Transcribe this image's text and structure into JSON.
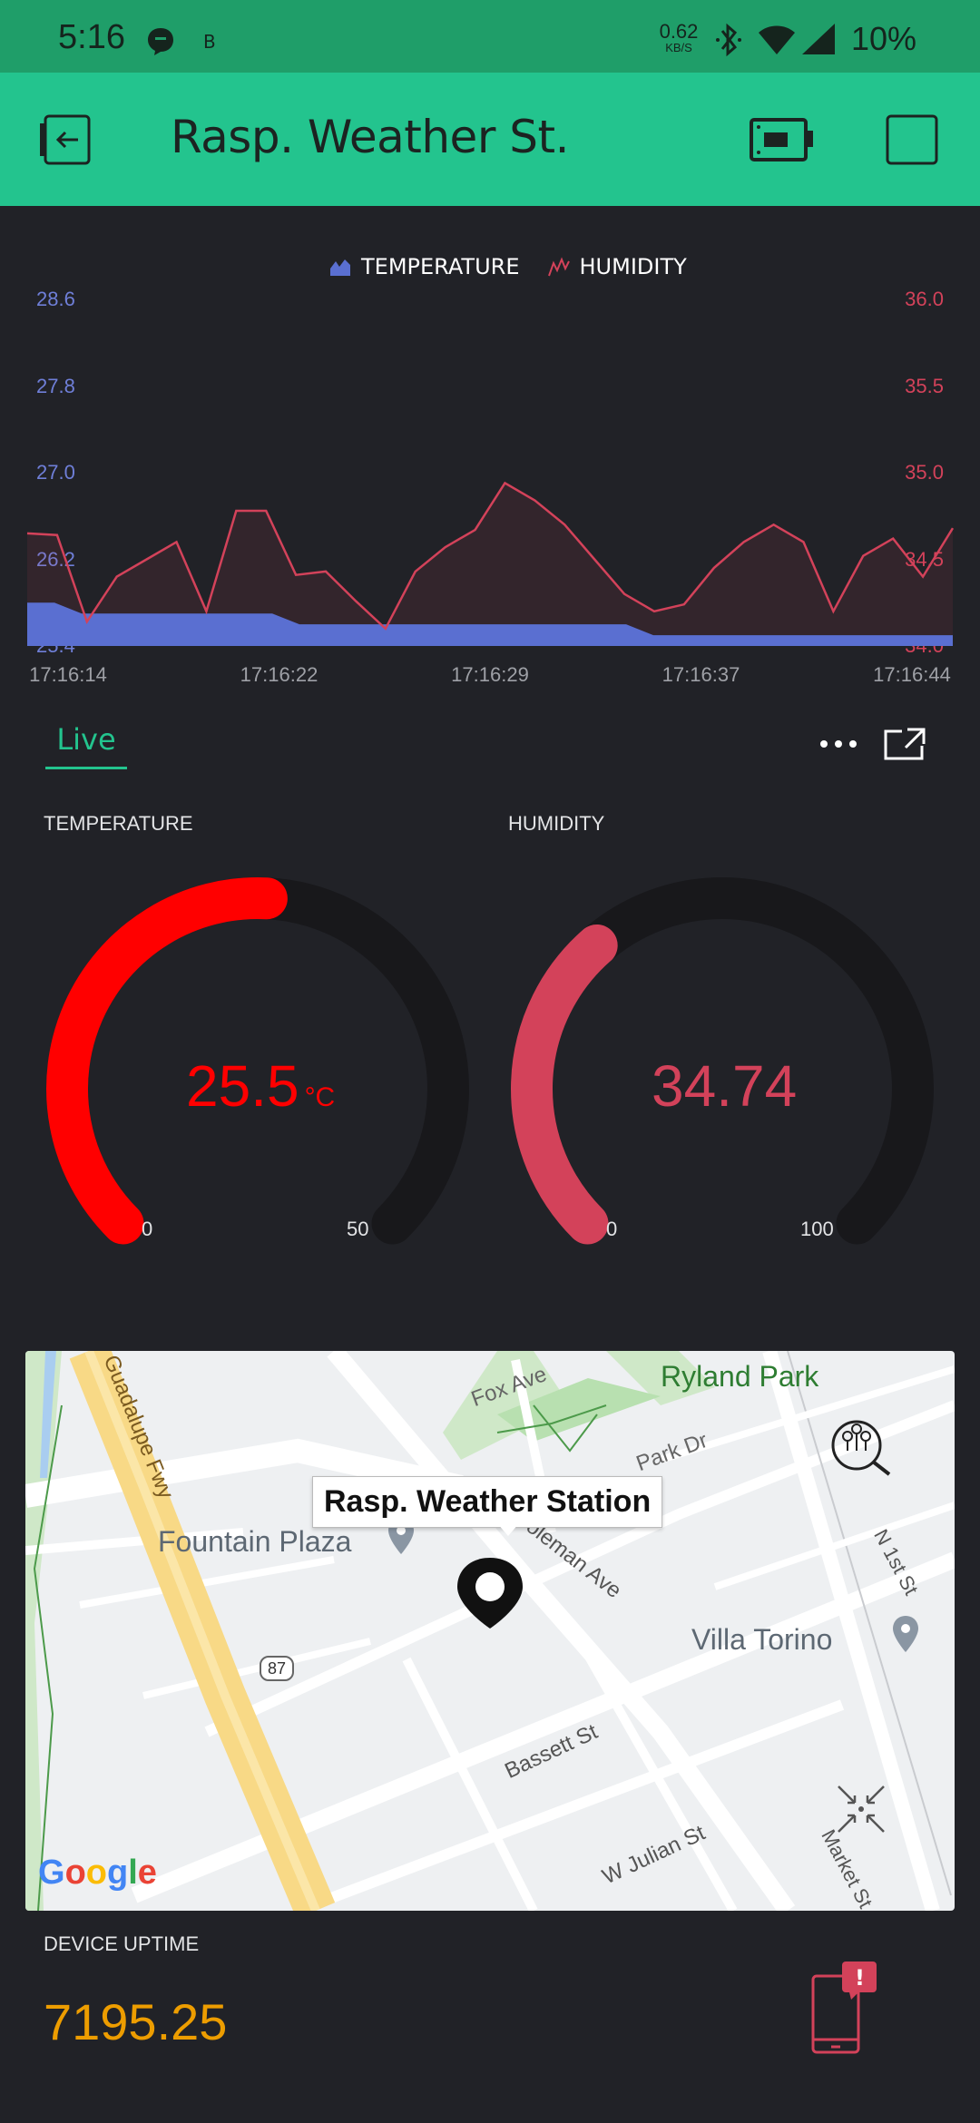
{
  "status_bar": {
    "time": "5:16",
    "net_speed": "0.62",
    "net_unit": "KB/S",
    "battery": "10%"
  },
  "app_bar": {
    "title": "Rasp. Weather St."
  },
  "chart_data": {
    "type": "area+line",
    "legend": [
      "TEMPERATURE",
      "HUMIDITY"
    ],
    "legend_placement": "top-center",
    "x_ticks": [
      "17:16:14",
      "17:16:22",
      "17:16:29",
      "17:16:37",
      "17:16:44"
    ],
    "left_axis": {
      "ticks": [
        "28.6",
        "27.8",
        "27.0",
        "26.2",
        "25.4"
      ],
      "ylim": [
        25.4,
        28.6
      ]
    },
    "right_axis": {
      "ticks": [
        "36.0",
        "35.5",
        "35.0",
        "34.5",
        "34.0"
      ],
      "ylim": [
        34.0,
        36.0
      ]
    },
    "series": [
      {
        "name": "TEMPERATURE",
        "axis": "left",
        "style": "area",
        "color": "#5a6fd1",
        "values": [
          25.8,
          25.8,
          25.7,
          25.7,
          25.7,
          25.7,
          25.7,
          25.7,
          25.7,
          25.7,
          25.6,
          25.6,
          25.6,
          25.6,
          25.6,
          25.6,
          25.6,
          25.6,
          25.6,
          25.6,
          25.6,
          25.6,
          25.6,
          25.5,
          25.5,
          25.5,
          25.5,
          25.5,
          25.5,
          25.5,
          25.5,
          25.5,
          25.5,
          25.5,
          25.5
        ]
      },
      {
        "name": "HUMIDITY",
        "axis": "right",
        "style": "line",
        "color": "#d3425a",
        "values": [
          34.65,
          34.64,
          34.14,
          34.4,
          34.5,
          34.6,
          34.2,
          34.78,
          34.78,
          34.41,
          34.43,
          34.26,
          34.1,
          34.43,
          34.57,
          34.67,
          34.94,
          34.84,
          34.7,
          34.5,
          34.3,
          34.2,
          34.24,
          34.45,
          34.6,
          34.7,
          34.6,
          34.2,
          34.52,
          34.62,
          34.4,
          34.68
        ]
      }
    ]
  },
  "tabs": {
    "live": "Live"
  },
  "gauges": {
    "temperature": {
      "title": "TEMPERATURE",
      "value": "25.5",
      "unit": "°C",
      "min": "0",
      "max": "50",
      "fraction": 0.51,
      "color": "#ff0000"
    },
    "humidity": {
      "title": "HUMIDITY",
      "value": "34.74",
      "min": "0",
      "max": "100",
      "fraction": 0.3474,
      "color": "#d3425a"
    }
  },
  "map": {
    "popup": "Rasp. Weather Station",
    "labels": {
      "ryland_park": "Ryland Park",
      "fox_ave": "Fox Ave",
      "park_dr": "Park Dr",
      "guadalupe_fwy": "Guadalupe Fwy",
      "fountain_plaza": "Fountain Plaza",
      "coleman_ave": "Coleman Ave",
      "n_1st_st": "N 1st St",
      "villa_torino": "Villa Torino",
      "route_87": "87",
      "bassett_st": "Bassett St",
      "w_julian_st": "W Julian St",
      "market_st": "Market St"
    },
    "brand": "Google"
  },
  "uptime": {
    "label": "DEVICE UPTIME",
    "value": "7195.25"
  }
}
